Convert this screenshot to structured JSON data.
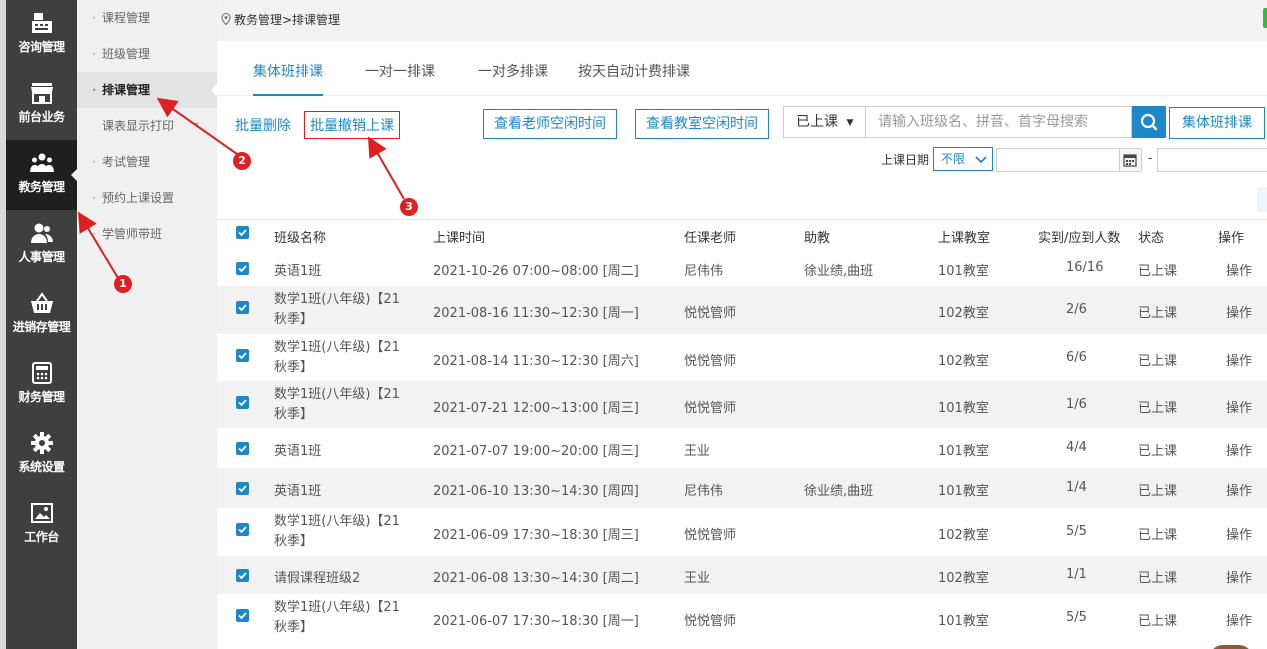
{
  "nav": {
    "items": [
      {
        "label": "咨询管理",
        "icon": "register-icon"
      },
      {
        "label": "前台业务",
        "icon": "storefront-icon"
      },
      {
        "label": "教务管理",
        "icon": "users-group-icon"
      },
      {
        "label": "人事管理",
        "icon": "people-icon"
      },
      {
        "label": "进销存管理",
        "icon": "basket-icon"
      },
      {
        "label": "财务管理",
        "icon": "calculator-icon"
      },
      {
        "label": "系统设置",
        "icon": "gear-icon"
      },
      {
        "label": "工作台",
        "icon": "picture-icon"
      }
    ]
  },
  "submenu": {
    "items": [
      {
        "label": "课程管理"
      },
      {
        "label": "班级管理"
      },
      {
        "label": "排课管理"
      },
      {
        "label": "课表显示打印"
      },
      {
        "label": "考试管理"
      },
      {
        "label": "预约上课设置"
      },
      {
        "label": "学管师带班"
      }
    ]
  },
  "breadcrumb": "教务管理>排课管理",
  "tabs": [
    "集体班排课",
    "一对一排课",
    "一对多排课",
    "按天自动计费排课"
  ],
  "toolbar": {
    "batch_delete": "批量删除",
    "batch_cancel": "批量撤销上课",
    "teacher_free": "查看老师空闲时间",
    "room_free": "查看教室空闲时间",
    "status_select": "已上课",
    "search_placeholder": "请输入班级名、拼音、首字母搜索",
    "group_schedule": "集体班排课",
    "date_label": "上课日期",
    "date_range": "不限",
    "date_sep": "-"
  },
  "table": {
    "headers": [
      "班级名称",
      "上课时间",
      "任课老师",
      "助教",
      "上课教室",
      "实到/应到人数",
      "状态",
      "操作"
    ],
    "rows": [
      {
        "name": "英语1班",
        "time": "2021-10-26 07:00~08:00 [周二]",
        "teacher": "尼伟伟",
        "assistant": "徐业绩,曲班",
        "room": "101教室",
        "count": "16/16",
        "status": "已上课",
        "op": "操作"
      },
      {
        "name": "数学1班(八年级)【21秋季】",
        "time": "2021-08-16 11:30~12:30 [周一]",
        "teacher": "悦悦管师",
        "assistant": "",
        "room": "102教室",
        "count": "2/6",
        "status": "已上课",
        "op": "操作"
      },
      {
        "name": "数学1班(八年级)【21秋季】",
        "time": "2021-08-14 11:30~12:30 [周六]",
        "teacher": "悦悦管师",
        "assistant": "",
        "room": "102教室",
        "count": "6/6",
        "status": "已上课",
        "op": "操作"
      },
      {
        "name": "数学1班(八年级)【21秋季】",
        "time": "2021-07-21 12:00~13:00 [周三]",
        "teacher": "悦悦管师",
        "assistant": "",
        "room": "101教室",
        "count": "1/6",
        "status": "已上课",
        "op": "操作"
      },
      {
        "name": "英语1班",
        "time": "2021-07-07 19:00~20:00 [周三]",
        "teacher": "王业",
        "assistant": "",
        "room": "101教室",
        "count": "4/4",
        "status": "已上课",
        "op": "操作"
      },
      {
        "name": "英语1班",
        "time": "2021-06-10 13:30~14:30 [周四]",
        "teacher": "尼伟伟",
        "assistant": "徐业绩,曲班",
        "room": "101教室",
        "count": "1/4",
        "status": "已上课",
        "op": "操作"
      },
      {
        "name": "数学1班(八年级)【21秋季】",
        "time": "2021-06-09 17:30~18:30 [周三]",
        "teacher": "悦悦管师",
        "assistant": "",
        "room": "102教室",
        "count": "5/5",
        "status": "已上课",
        "op": "操作"
      },
      {
        "name": "请假课程班级2",
        "time": "2021-06-08 13:30~14:30 [周二]",
        "teacher": "王业",
        "assistant": "",
        "room": "102教室",
        "count": "1/1",
        "status": "已上课",
        "op": "操作"
      },
      {
        "name": "数学1班(八年级)【21秋季】",
        "time": "2021-06-07 17:30~18:30 [周一]",
        "teacher": "悦悦管师",
        "assistant": "",
        "room": "101教室",
        "count": "5/5",
        "status": "已上课",
        "op": "操作"
      }
    ]
  },
  "annotations": {
    "badges": [
      "1",
      "2",
      "3"
    ]
  },
  "colors": {
    "accent": "#1e88c7",
    "annotation": "#e02020",
    "nav_bg": "#3f3f3f",
    "nav_active": "#1f1f1f"
  }
}
